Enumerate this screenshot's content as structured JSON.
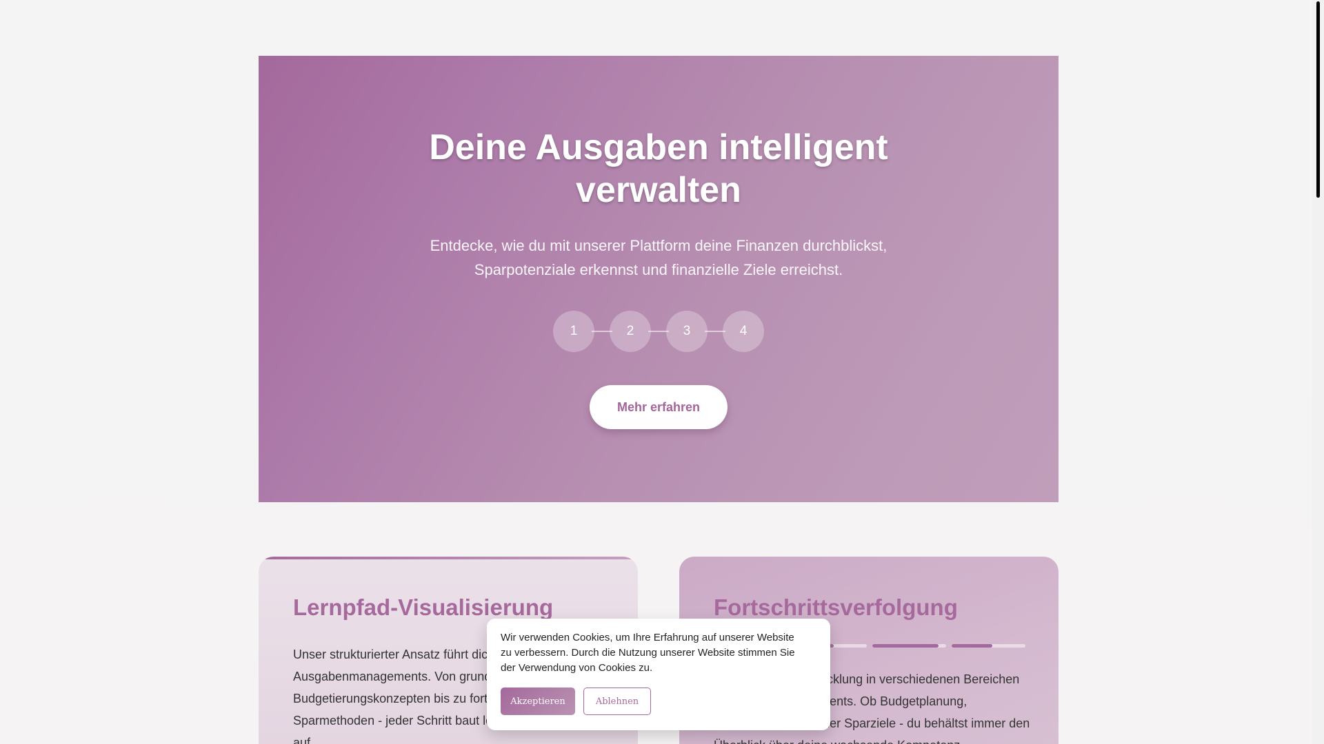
{
  "hero": {
    "title": "Deine Ausgaben intelligent verwalten",
    "subtitle": "Entdecke, wie du mit unserer Plattform deine Finanzen durchblickst, Sparpotenziale erkennst und finanzielle Ziele erreichst.",
    "steps": [
      "1",
      "2",
      "3",
      "4"
    ],
    "cta_label": "Mehr erfahren"
  },
  "cards": {
    "left": {
      "title": "Lernpfad-Visualisierung",
      "text": "Unser strukturierter Ansatz führt dich durch die Welt des Ausgabenmanagements. Von grundlegenden Budgetierungskonzepten bis zu fortgeschrittenen Sparmethoden - jeder Schritt baut logisch aufeinander auf."
    },
    "right": {
      "title": "Fortschrittsverfolgung",
      "progress": [
        0.9,
        0.55,
        0.9,
        0.55
      ],
      "text": "Verfolge deine Entwicklung in verschiedenen Bereichen des Finanzmanagements. Ob Budgetplanung, Ausgabenanalyse oder Sparziele - du behältst immer den Überblick über deine wachsende Kompetenz."
    }
  },
  "cookie": {
    "text": "Wir verwenden Cookies, um Ihre Erfahrung auf unserer Website zu verbessern. Durch die Nutzung unserer Website stimmen Sie der Verwendung von Cookies zu.",
    "accept_label": "Akzeptieren",
    "decline_label": "Ablehnen"
  },
  "colors": {
    "accent": "#a4699c",
    "card_title": "#a6699c"
  }
}
